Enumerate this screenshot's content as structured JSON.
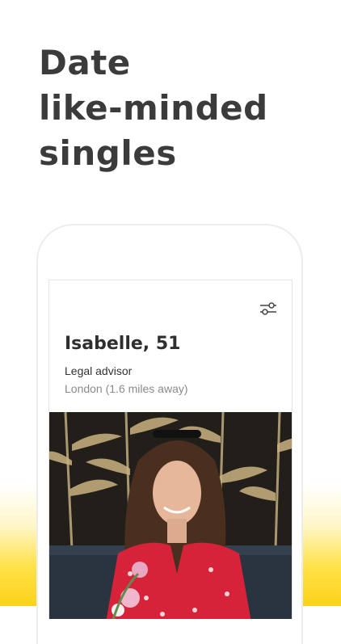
{
  "headline": {
    "line1": "Date",
    "line2": "like-minded",
    "line3": "singles"
  },
  "profile": {
    "name_age": "Isabelle, 51",
    "occupation": "Legal advisor",
    "location": "London (1.6 miles away)"
  },
  "icons": {
    "filter": "sliders-filter-icon"
  },
  "colors": {
    "accent_yellow": "#fcd31a",
    "text_dark": "#3b3b3b",
    "text_muted": "#8a8a8a"
  }
}
